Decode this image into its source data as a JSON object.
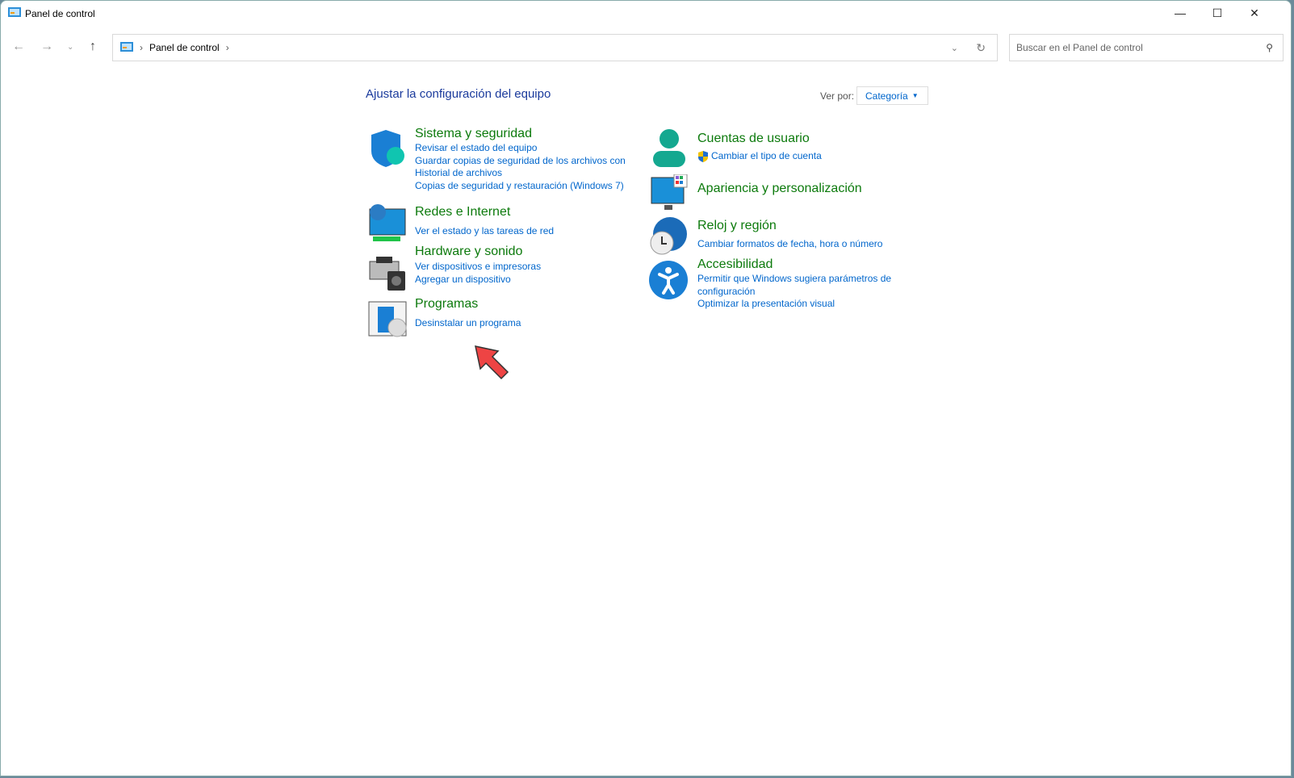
{
  "window": {
    "title": "Panel de control"
  },
  "address": {
    "crumb": "Panel de control",
    "search_placeholder": "Buscar en el Panel de control"
  },
  "main": {
    "heading": "Ajustar la configuración del equipo",
    "view_by_label": "Ver por:",
    "view_by_value": "Categoría"
  },
  "categories": [
    {
      "title": "Sistema y seguridad",
      "links": [
        "Revisar el estado del equipo",
        "Guardar copias de seguridad de los archivos con Historial de archivos",
        "Copias de seguridad y restauración (Windows 7)"
      ]
    },
    {
      "title": "Redes e Internet",
      "links": [
        "Ver el estado y las tareas de red"
      ]
    },
    {
      "title": "Hardware y sonido",
      "links": [
        "Ver dispositivos e impresoras",
        "Agregar un dispositivo"
      ]
    },
    {
      "title": "Programas",
      "links": [
        "Desinstalar un programa"
      ]
    },
    {
      "title": "Cuentas de usuario",
      "links": [
        "Cambiar el tipo de cuenta"
      ]
    },
    {
      "title": "Apariencia y personalización",
      "links": []
    },
    {
      "title": "Reloj y región",
      "links": [
        "Cambiar formatos de fecha, hora o número"
      ]
    },
    {
      "title": "Accesibilidad",
      "links": [
        "Permitir que Windows sugiera parámetros de configuración",
        "Optimizar la presentación visual"
      ]
    }
  ],
  "colors": {
    "category": "#0c7a0c",
    "link": "#0066cc",
    "heading": "#1a3a9c"
  }
}
